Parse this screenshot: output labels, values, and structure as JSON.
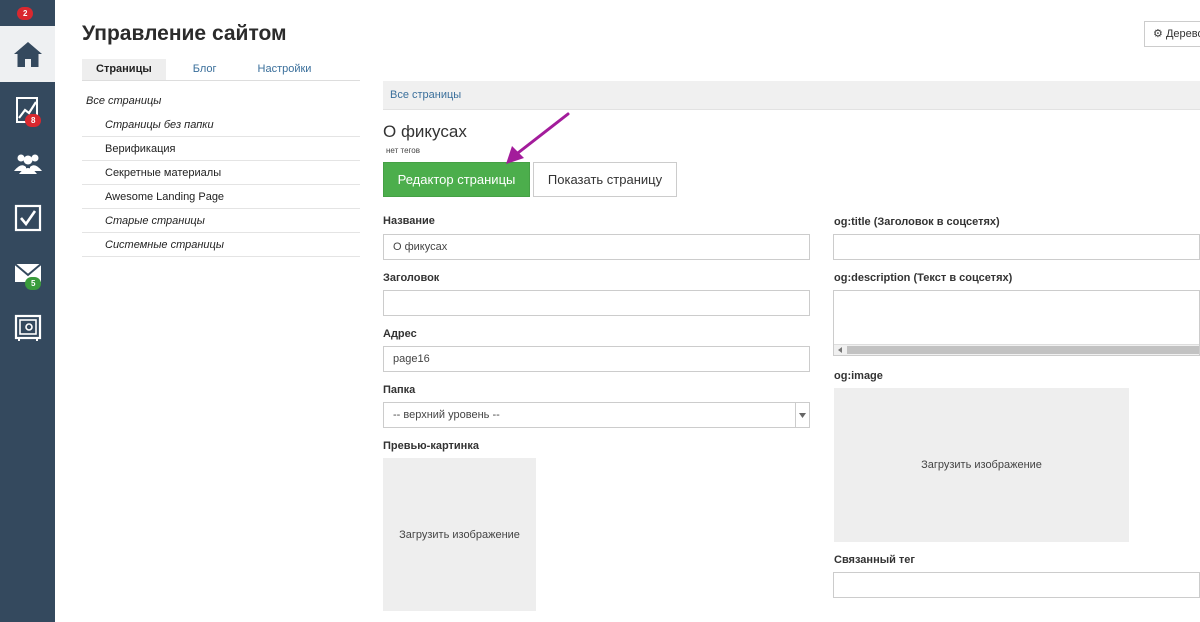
{
  "sidebar": {
    "top_badge": "2",
    "items": [
      {
        "icon": "home-icon",
        "badge": ""
      },
      {
        "icon": "chart-icon",
        "badge": "8"
      },
      {
        "icon": "users-icon",
        "badge": ""
      },
      {
        "icon": "checkbox-icon",
        "badge": ""
      },
      {
        "icon": "mail-icon",
        "badge": "5"
      },
      {
        "icon": "safe-icon",
        "badge": ""
      }
    ]
  },
  "header": {
    "title": "Управление сайтом",
    "tree_button": "Дерево"
  },
  "tabs": [
    "Страницы",
    "Блог",
    "Настройки"
  ],
  "tree": {
    "root": "Все страницы",
    "items": [
      "Страницы без папки",
      "Верификация",
      "Секретные материалы",
      "Awesome Landing Page",
      "Старые страницы",
      "Системные страницы"
    ]
  },
  "breadcrumb": "Все страницы",
  "page": {
    "title": "О фикусах",
    "tags": "нет тегов",
    "editor_button": "Редактор страницы",
    "show_button": "Показать страницу"
  },
  "form": {
    "name_label": "Название",
    "name_value": "О фикусах",
    "heading_label": "Заголовок",
    "heading_value": "",
    "address_label": "Адрес",
    "address_value": "page16",
    "folder_label": "Папка",
    "folder_value": "-- верхний уровень --",
    "preview_label": "Превью-картинка",
    "upload_text": "Загрузить изображение",
    "og_title_label": "og:title (Заголовок в соцсетях)",
    "og_description_label": "og:description (Текст в соцсетях)",
    "og_image_label": "og:image",
    "og_upload_text": "Загрузить изображение",
    "linked_tag_label": "Связанный тег"
  },
  "colors": {
    "sidebar": "#34495e",
    "accent_green": "#4cae4c",
    "link_blue": "#3a6f9b",
    "badge_red": "#d9282f",
    "badge_green": "#3a9b3c",
    "annotation_arrow": "#a31c9b"
  }
}
